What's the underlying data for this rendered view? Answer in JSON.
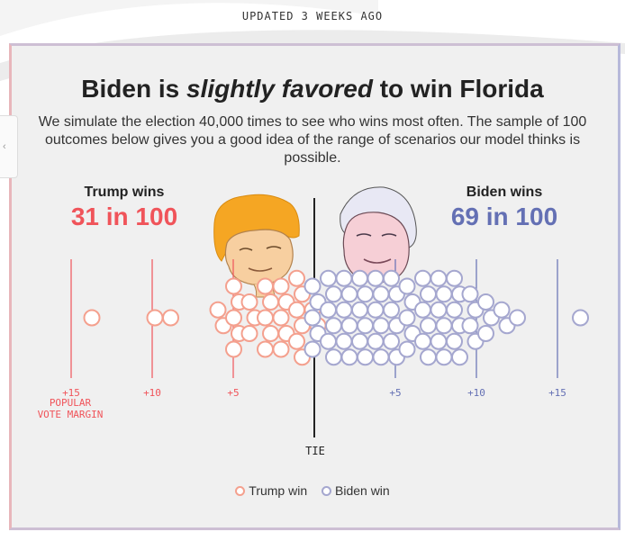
{
  "updated_label": "UPDATED 3 WEEKS AGO",
  "headline": {
    "prefix": "Biden is ",
    "emphasis": "slightly favored",
    "suffix": " to win Florida"
  },
  "dek": "We simulate the election 40,000 times to see who wins most often. The sample of 100 outcomes below gives you a good idea of the range of scenarios our model thinks is possible.",
  "trump": {
    "label": "Trump wins",
    "count": "31 in 100",
    "color": "#f0545a",
    "dot_color": "#f4a08e"
  },
  "biden": {
    "label": "Biden wins",
    "count": "69 in 100",
    "color": "#6470b4",
    "dot_color": "#a5a7cf"
  },
  "axis": {
    "margin_label": "POPULAR VOTE MARGIN",
    "tie_label": "TIE",
    "left_ticks": [
      "+15",
      "+10",
      "+5"
    ],
    "right_ticks": [
      "+5",
      "+10",
      "+15"
    ]
  },
  "legend": {
    "trump": "Trump win",
    "biden": "Biden win"
  },
  "chart_data": {
    "type": "scatter",
    "title": "Biden is slightly favored to win Florida",
    "xlabel": "POPULAR VOTE MARGIN",
    "x_ticks": [
      "+15",
      "+10",
      "+5",
      "TIE",
      "+5",
      "+10",
      "+15"
    ],
    "xlim": [
      -15,
      17
    ],
    "series": [
      {
        "name": "Trump win",
        "count": 31,
        "x_margin": [
          -14.0,
          -9.6,
          -9.1,
          -5.4,
          -5.3,
          -5.2,
          -5.0,
          -4.7,
          -4.5,
          -4.4,
          -4.3,
          -4.0,
          -3.5,
          -3.3,
          -3.1,
          -2.9,
          -2.5,
          -2.4,
          -2.1,
          -2.0,
          -1.9,
          -1.6,
          -1.5,
          -1.3,
          -1.2,
          -1.0,
          -0.9,
          -0.8,
          -0.7,
          -0.4,
          -0.3
        ]
      },
      {
        "name": "Biden win",
        "count": 69,
        "x_margin": [
          0.1,
          0.2,
          0.3,
          0.4,
          0.5,
          0.6,
          0.7,
          1.0,
          1.2,
          1.3,
          1.5,
          1.6,
          1.8,
          1.9,
          2.0,
          2.2,
          2.4,
          2.5,
          2.7,
          2.9,
          3.0,
          3.2,
          3.4,
          3.5,
          3.7,
          3.9,
          4.0,
          4.2,
          4.4,
          4.5,
          4.7,
          4.9,
          5.0,
          5.2,
          5.4,
          5.5,
          5.7,
          5.9,
          6.0,
          6.2,
          6.4,
          6.5,
          6.7,
          6.9,
          7.0,
          7.2,
          7.4,
          7.5,
          7.7,
          7.9,
          8.0,
          8.2,
          8.4,
          8.5,
          8.7,
          8.9,
          9.0,
          9.2,
          9.4,
          9.5,
          9.7,
          10.0,
          10.3,
          10.6,
          11.0,
          11.4,
          12.0,
          12.4,
          17.0
        ]
      }
    ]
  }
}
